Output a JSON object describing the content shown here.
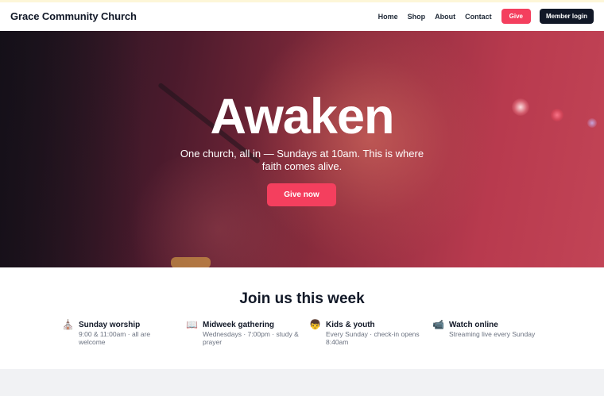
{
  "header": {
    "brand": "Grace Community Church",
    "nav": [
      "Home",
      "Shop",
      "About",
      "Contact"
    ],
    "give_label": "Give",
    "member_login_label": "Member login"
  },
  "hero": {
    "title": "Awaken",
    "subtitle": "One church, all in — Sundays at 10am. This is where faith comes alive.",
    "cta_label": "Give now"
  },
  "week": {
    "title": "Join us this week",
    "items": [
      {
        "icon": "church-icon",
        "glyph": "⛪",
        "title": "Sunday worship",
        "desc": "9:00 & 11:00am · all are welcome"
      },
      {
        "icon": "book-icon",
        "glyph": "📖",
        "title": "Midweek gathering",
        "desc": "Wednesdays · 7:00pm · study & prayer"
      },
      {
        "icon": "child-icon",
        "glyph": "👦",
        "title": "Kids & youth",
        "desc": "Every Sunday · check-in opens 8:40am"
      },
      {
        "icon": "video-camera-icon",
        "glyph": "📹",
        "title": "Watch online",
        "desc": "Streaming live every Sunday"
      }
    ]
  },
  "colors": {
    "accent": "#f43f5e",
    "dark": "#111827",
    "muted_text": "#6b7280"
  }
}
